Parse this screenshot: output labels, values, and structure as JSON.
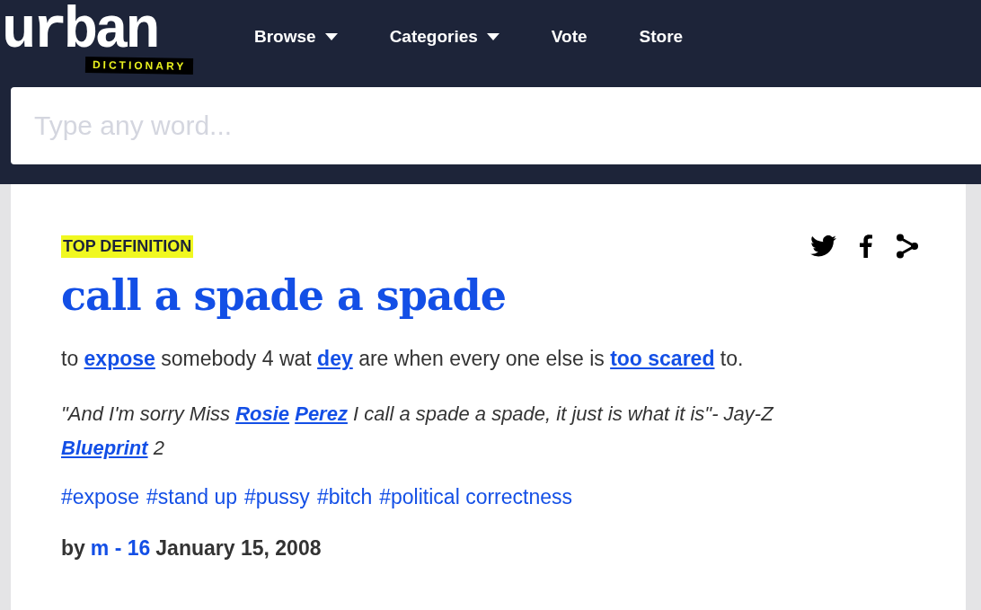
{
  "logo": {
    "word": "urban",
    "badge": "DICTIONARY"
  },
  "nav": [
    {
      "label": "Browse",
      "dropdown": true
    },
    {
      "label": "Categories",
      "dropdown": true
    },
    {
      "label": "Vote",
      "dropdown": false
    },
    {
      "label": "Store",
      "dropdown": false
    }
  ],
  "search": {
    "placeholder": "Type any word..."
  },
  "definition": {
    "badge": "TOP DEFINITION",
    "word": "call a spade a spade",
    "meaning": [
      {
        "kind": "text",
        "text": "to "
      },
      {
        "kind": "link",
        "text": "expose"
      },
      {
        "kind": "text",
        "text": " somebody 4 wat "
      },
      {
        "kind": "link",
        "text": "dey"
      },
      {
        "kind": "text",
        "text": " are when every one else is "
      },
      {
        "kind": "link",
        "text": "too scared"
      },
      {
        "kind": "text",
        "text": " to."
      }
    ],
    "example": [
      {
        "kind": "text",
        "text": "\"And I'm sorry Miss "
      },
      {
        "kind": "link",
        "text": "Rosie"
      },
      {
        "kind": "link",
        "text": "Perez"
      },
      {
        "kind": "text",
        "text": " I call a spade a spade, it just is what it is\"- Jay-Z "
      },
      {
        "kind": "link",
        "text": "Blueprint"
      },
      {
        "kind": "text",
        "text": " 2"
      }
    ],
    "tags": [
      "#expose",
      "#stand up",
      "#pussy",
      "#bitch",
      "#political correctness"
    ],
    "by": "by",
    "author": "m - 16",
    "date": "January 15, 2008"
  }
}
